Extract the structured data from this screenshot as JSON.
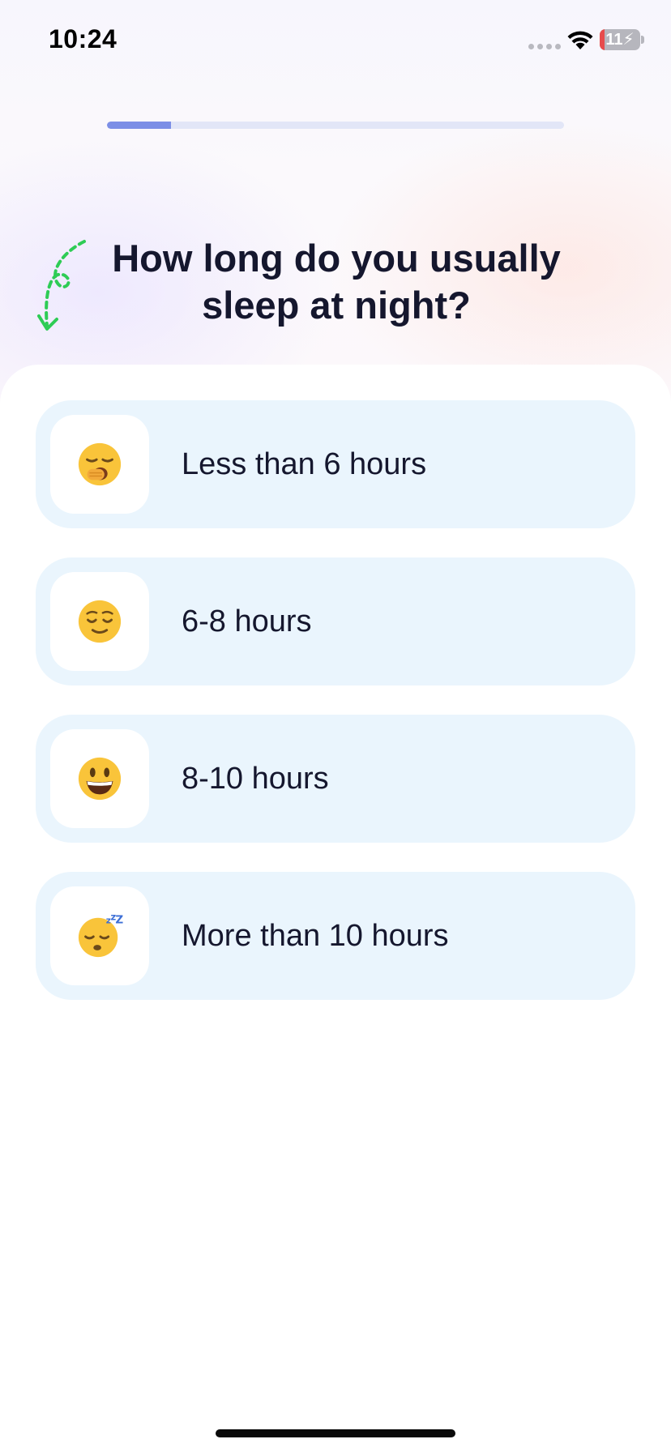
{
  "status_bar": {
    "time": "10:24",
    "battery_level": "11",
    "battery_fraction": 0.11,
    "battery_color": "#e74c4c"
  },
  "progress": {
    "fraction": 0.14,
    "fill_color": "#7c8fe6",
    "track_color": "#e2e6f7"
  },
  "decoration": {
    "icon": "dashed-curved-arrow-icon",
    "color": "#2ecc55"
  },
  "question": "How long do you usually sleep at night?",
  "options": [
    {
      "label": "Less than 6 hours",
      "icon": "yawning-face-icon"
    },
    {
      "label": "6-8 hours",
      "icon": "relieved-face-icon"
    },
    {
      "label": "8-10 hours",
      "icon": "smiling-face-icon"
    },
    {
      "label": "More than 10 hours",
      "icon": "sleeping-face-icon"
    }
  ],
  "colors": {
    "option_bg": "#eaf5fd",
    "text": "#15172e"
  }
}
